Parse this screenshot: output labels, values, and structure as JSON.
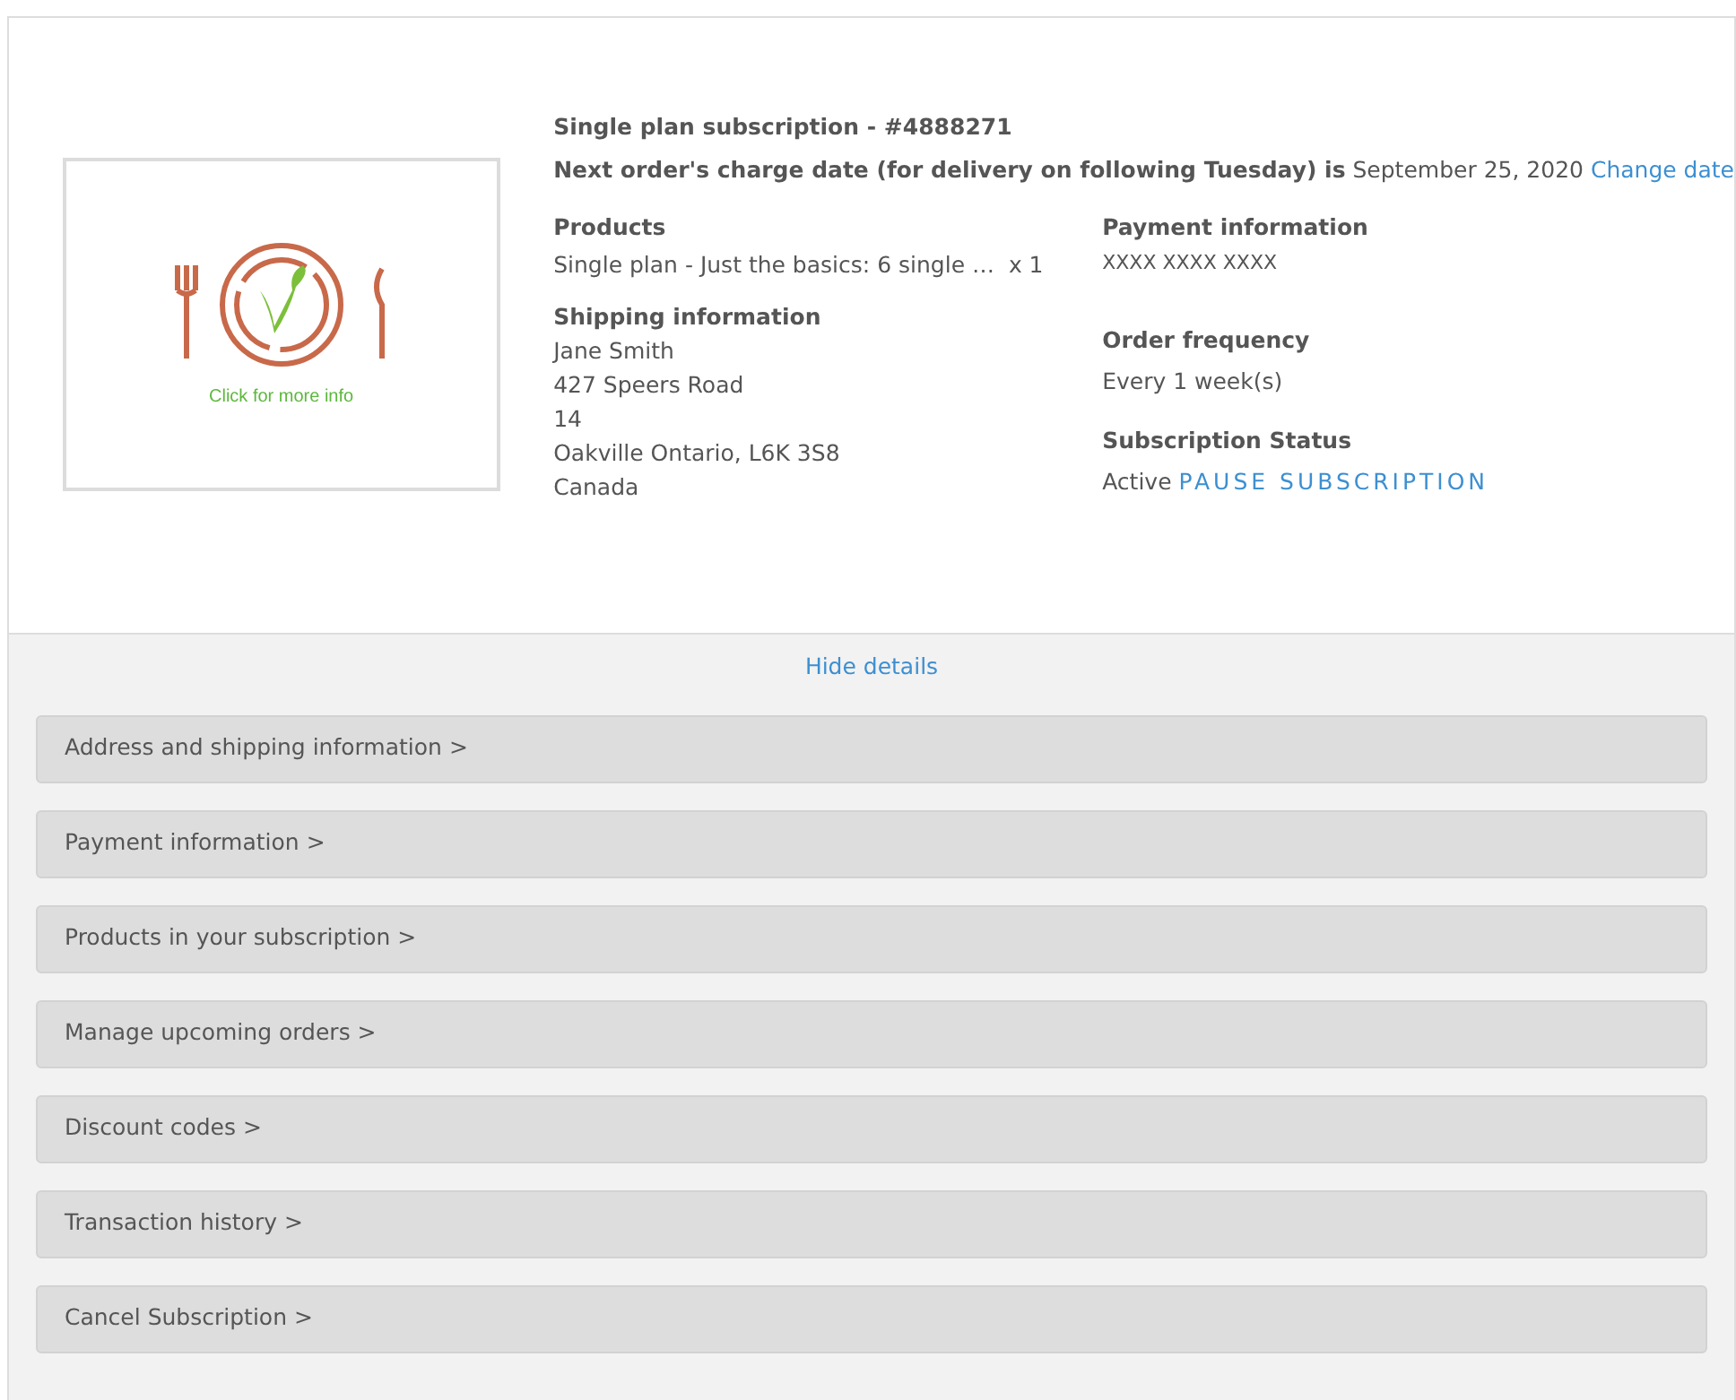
{
  "product_image": {
    "caption": "Click for more info"
  },
  "subscription": {
    "title": "Single plan subscription - #4888271",
    "charge_label": "Next order's charge date (for delivery on following Tuesday) is",
    "charge_date": "September 25, 2020",
    "change_link": "Change date"
  },
  "products": {
    "heading": "Products",
    "item": "Single plan - Just the basics: 6 single …",
    "quantity": "x 1"
  },
  "shipping": {
    "heading": "Shipping information",
    "lines": [
      "Jane Smith",
      "427 Speers Road",
      "14",
      "Oakville Ontario, L6K 3S8",
      "Canada"
    ]
  },
  "payment": {
    "heading": "Payment information",
    "value": "XXXX XXXX XXXX"
  },
  "frequency": {
    "heading": "Order frequency",
    "value": "Every 1 week(s)"
  },
  "status": {
    "heading": "Subscription Status",
    "value": "Active",
    "action": "PAUSE SUBSCRIPTION"
  },
  "hide_link": "Hide details",
  "sections": [
    {
      "label": "Address and shipping information >"
    },
    {
      "label": "Payment information >"
    },
    {
      "label": "Products in your subscription >"
    },
    {
      "label": "Manage upcoming orders >"
    },
    {
      "label": "Discount codes >"
    },
    {
      "label": "Transaction history >"
    },
    {
      "label": "Cancel Subscription >"
    }
  ]
}
